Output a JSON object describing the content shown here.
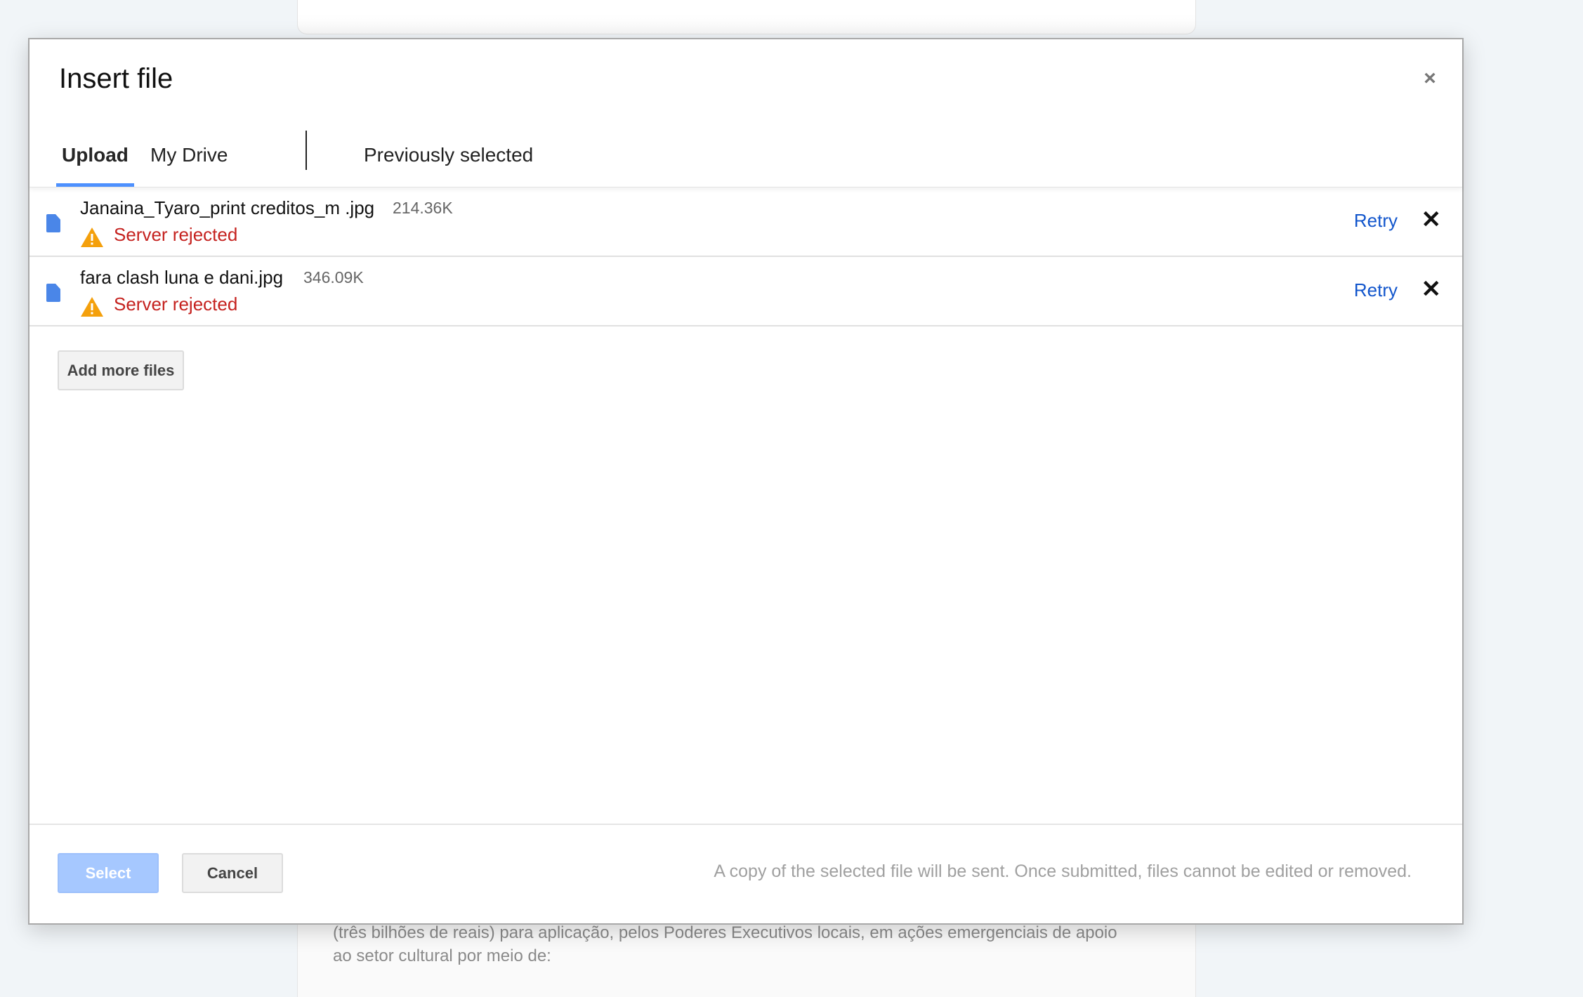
{
  "background": {
    "paragraph_lines": [
      "(três bilhões de reais) para aplicação, pelos Poderes Executivos locais, em ações emergenciais de apoio",
      "ao setor cultural por meio de:"
    ]
  },
  "dialog": {
    "title": "Insert file",
    "close_icon": "×",
    "tabs": [
      {
        "label": "Upload",
        "active": true
      },
      {
        "label": "My Drive",
        "active": false
      },
      {
        "label": "Previously selected",
        "active": false
      }
    ],
    "files": [
      {
        "name": "Janaina_Tyaro_print creditos_m .jpg",
        "size": "214.36K",
        "status": "Server rejected",
        "retry_label": "Retry",
        "remove_icon": "✕"
      },
      {
        "name": "fara clash luna e dani.jpg",
        "size": "346.09K",
        "status": "Server rejected",
        "retry_label": "Retry",
        "remove_icon": "✕"
      }
    ],
    "add_more_label": "Add more files",
    "footer": {
      "select_label": "Select",
      "cancel_label": "Cancel",
      "note": "A copy of the selected file will be sent. Once submitted, files cannot be edited or removed."
    }
  },
  "colors": {
    "accent": "#4d90fe",
    "link": "#1155cc",
    "error": "#c5221f",
    "warning": "#f4a00c",
    "file_icon": "#4a86e8",
    "select_disabled": "#a6c8ff"
  }
}
